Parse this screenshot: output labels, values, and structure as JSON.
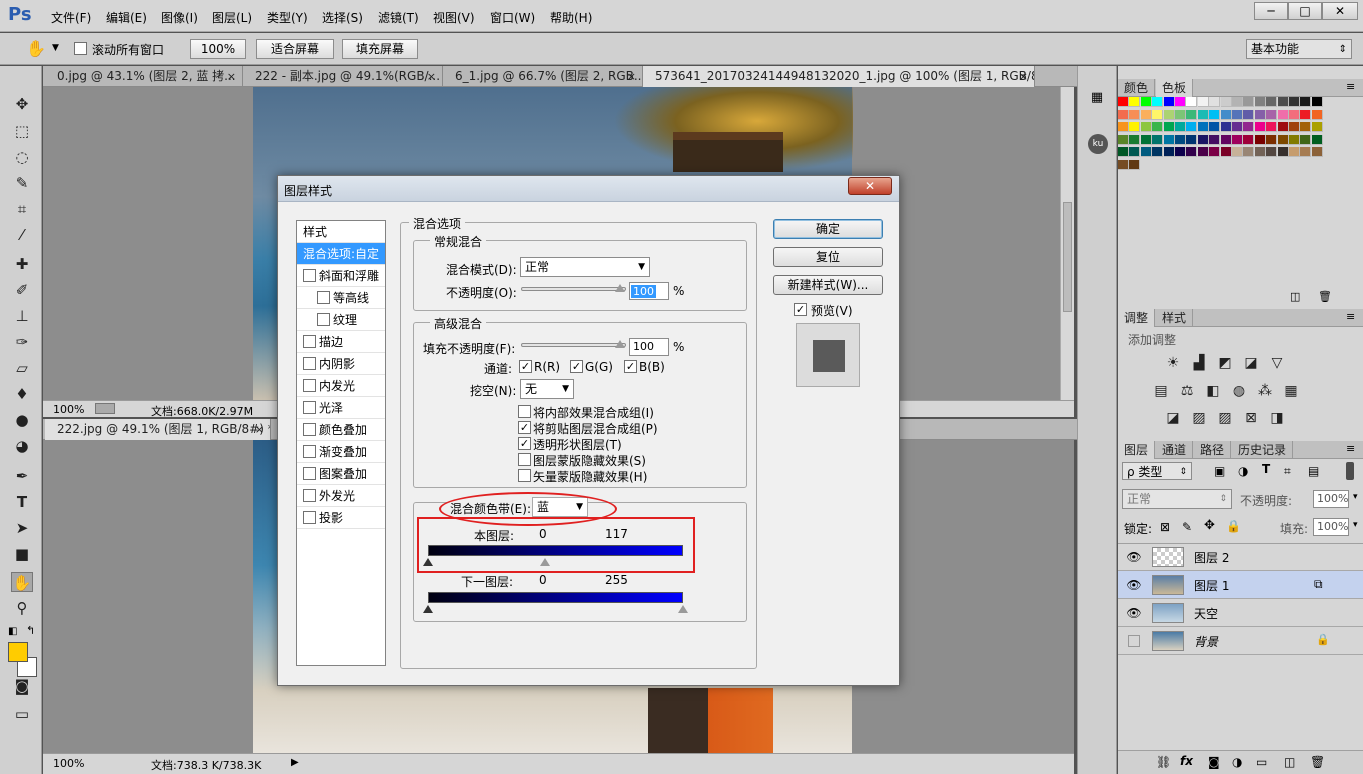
{
  "app": {
    "logo": "Ps"
  },
  "menu": [
    "文件(F)",
    "编辑(E)",
    "图像(I)",
    "图层(L)",
    "类型(Y)",
    "选择(S)",
    "滤镜(T)",
    "视图(V)",
    "窗口(W)",
    "帮助(H)"
  ],
  "window_controls": {
    "minimize": "─",
    "maximize": "□",
    "close": "✕"
  },
  "options_bar": {
    "scroll_all_label": "滚动所有窗口",
    "zoom_value": "100%",
    "fit_screen": "适合屏幕",
    "fill_screen": "填充屏幕",
    "workspace": "基本功能"
  },
  "doc_tabs_top": [
    "0.jpg @ 43.1% (图层 2, 蓝 拷...",
    "222 - 副本.jpg @ 49.1%(RGB/...",
    "6_1.jpg @ 66.7% (图层 2, RGB...",
    "573641_20170324144948132020_1.jpg @ 100% (图层 1, RGB/8#) *"
  ],
  "tab_close": "×",
  "status_top": {
    "zoom": "100%",
    "doc": "文档:668.0K/2.97M"
  },
  "doc_tab_bottom": "222.jpg @ 49.1% (图层 1, RGB/8#) *",
  "status_bottom": {
    "zoom": "100%",
    "doc": "文档:738.3 K/738.3K"
  },
  "right_panels": {
    "swatch_tabs": [
      "颜色",
      "色板"
    ],
    "adjust_tabs": [
      "调整",
      "样式"
    ],
    "adjust_title": "添加调整",
    "layers_tabs": [
      "图层",
      "通道",
      "路径",
      "历史记录"
    ],
    "filter_kind": "ρ 类型",
    "blend_mode": "正常",
    "opacity_label": "不透明度:",
    "opacity_value": "100%",
    "lock_label": "锁定:",
    "fill_label": "填充:",
    "fill_value": "100%",
    "layers": [
      {
        "name": "图层 2",
        "visible": true,
        "selected": false
      },
      {
        "name": "图层 1",
        "visible": true,
        "selected": true
      },
      {
        "name": "天空",
        "visible": true,
        "selected": false
      },
      {
        "name": "背景",
        "visible": false,
        "selected": false
      }
    ],
    "ku_badge": "ku",
    "swatch_colors": [
      "#ff0000",
      "#ffff00",
      "#00ff00",
      "#00ffff",
      "#0000ff",
      "#ff00ff",
      "#ffffff",
      "#f2f2f2",
      "#e0e0e0",
      "#cccccc",
      "#b3b3b3",
      "#999999",
      "#808080",
      "#666666",
      "#4d4d4d",
      "#333333",
      "#1a1a1a",
      "#000000",
      "#f26c4f",
      "#f68e56",
      "#fbaf5c",
      "#fff568",
      "#acd372",
      "#7cc576",
      "#3bb878",
      "#1abbb4",
      "#00bff3",
      "#438cca",
      "#5574b9",
      "#605ca8",
      "#855fa8",
      "#a763a8",
      "#f06eaa",
      "#f26d7d",
      "#ed1c24",
      "#f26522",
      "#f7941d",
      "#fff200",
      "#8dc63f",
      "#39b54a",
      "#00a651",
      "#00a99d",
      "#00aeef",
      "#0072bc",
      "#0054a6",
      "#2e3192",
      "#662d91",
      "#92278f",
      "#ec008c",
      "#ed145b",
      "#9e0b0f",
      "#a0410d",
      "#a36209",
      "#aba000",
      "#598527",
      "#197b30",
      "#007236",
      "#00746b",
      "#0076a3",
      "#004a80",
      "#003471",
      "#1b1464",
      "#440e62",
      "#630460",
      "#9e005d",
      "#9e0039",
      "#790000",
      "#7b2e00",
      "#7d4900",
      "#827b00",
      "#406618",
      "#005e20",
      "#005826",
      "#005952",
      "#005b7f",
      "#003663",
      "#002157",
      "#0d004c",
      "#32004b",
      "#4b0049",
      "#7b0046",
      "#7a0026",
      "#c7b299",
      "#998675",
      "#736357",
      "#534741",
      "#37302d",
      "#c69c6d",
      "#a67c52",
      "#8c6239",
      "#754c24",
      "#603913"
    ]
  },
  "dialog": {
    "title": "图层样式",
    "close": "✕",
    "styles_header": "样式",
    "blend_options_item": "混合选项:自定",
    "style_items": [
      {
        "label": "斜面和浮雕",
        "indent": false
      },
      {
        "label": "等高线",
        "indent": true
      },
      {
        "label": "纹理",
        "indent": true
      },
      {
        "label": "描边",
        "indent": false
      },
      {
        "label": "内阴影",
        "indent": false
      },
      {
        "label": "内发光",
        "indent": false
      },
      {
        "label": "光泽",
        "indent": false
      },
      {
        "label": "颜色叠加",
        "indent": false
      },
      {
        "label": "渐变叠加",
        "indent": false
      },
      {
        "label": "图案叠加",
        "indent": false
      },
      {
        "label": "外发光",
        "indent": false
      },
      {
        "label": "投影",
        "indent": false
      }
    ],
    "blend_options_legend": "混合选项",
    "general_legend": "常规混合",
    "blend_mode_label": "混合模式(D):",
    "blend_mode_value": "正常",
    "opacity_label": "不透明度(O):",
    "opacity_value": "100",
    "percent": "%",
    "advanced_legend": "高级混合",
    "fill_opacity_label": "填充不透明度(F):",
    "fill_opacity_value": "100",
    "channels_label": "通道:",
    "channel_r": "R(R)",
    "channel_g": "G(G)",
    "channel_b": "B(B)",
    "knockout_label": "挖空(N):",
    "knockout_value": "无",
    "adv_checks": [
      {
        "label": "将内部效果混合成组(I)",
        "checked": false
      },
      {
        "label": "将剪贴图层混合成组(P)",
        "checked": true
      },
      {
        "label": "透明形状图层(T)",
        "checked": true
      },
      {
        "label": "图层蒙版隐藏效果(S)",
        "checked": false
      },
      {
        "label": "矢量蒙版隐藏效果(H)",
        "checked": false
      }
    ],
    "blend_if_label": "混合颜色带(E):",
    "blend_if_value": "蓝",
    "this_layer_label": "本图层:",
    "this_layer_low": "0",
    "this_layer_high": "117",
    "this_layer_high_fraction": 0.459,
    "under_layer_label": "下一图层:",
    "under_layer_low": "0",
    "under_layer_high": "255",
    "under_layer_high_fraction": 1.0,
    "check_mark": "✓",
    "buttons": {
      "ok": "确定",
      "reset": "复位",
      "new_style": "新建样式(W)...",
      "preview": "预览(V)"
    },
    "highlight_color": "#e02020"
  }
}
